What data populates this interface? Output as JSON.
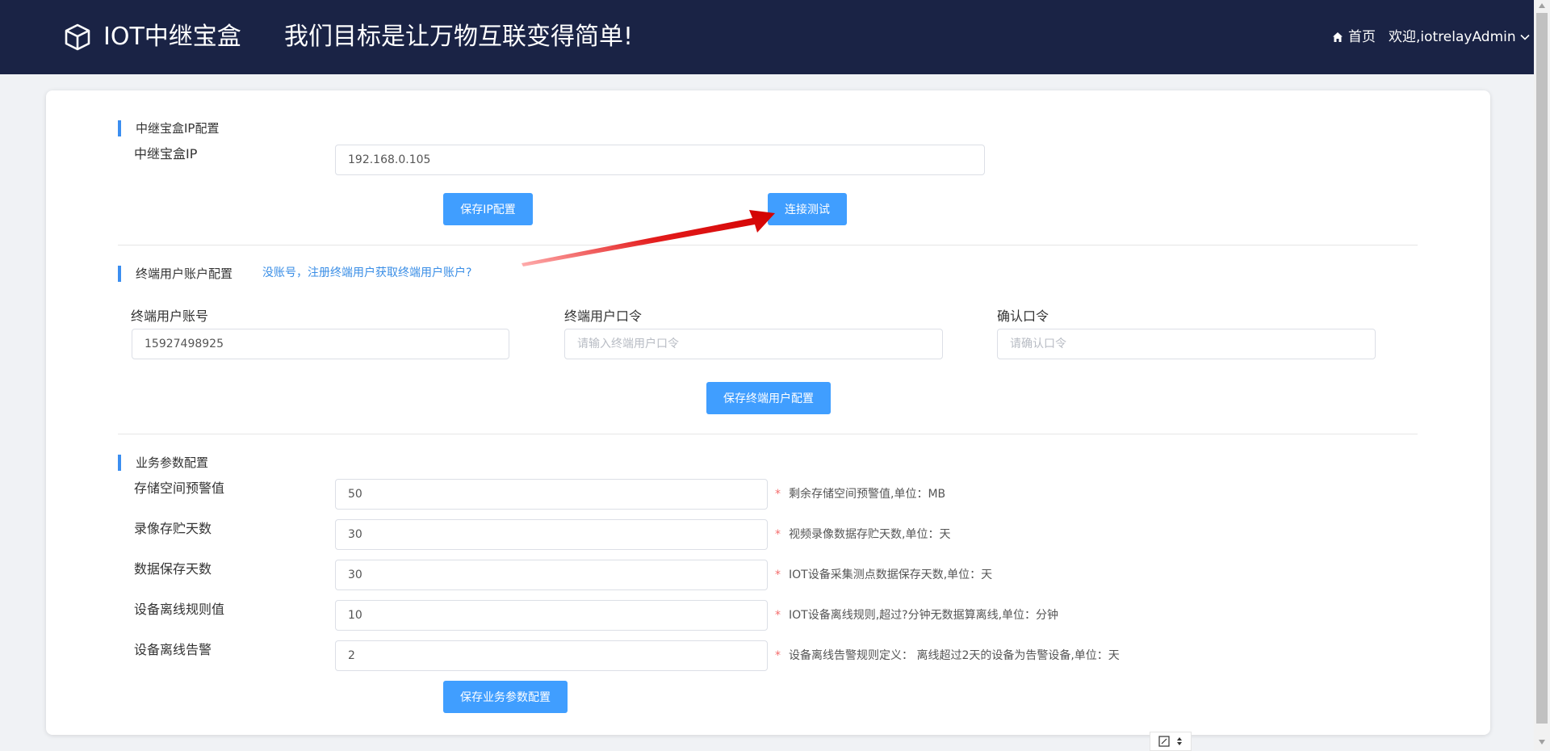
{
  "header": {
    "brand": "IOT中继宝盒",
    "slogan": "我们目标是让万物互联变得简单!",
    "home_label": "首页",
    "user_label": "欢迎,iotrelayAdmin"
  },
  "ip_section": {
    "title": "中继宝盒IP配置",
    "ip_label": "中继宝盒IP",
    "ip_value": "192.168.0.105",
    "save_button": "保存IP配置",
    "test_button": "连接测试"
  },
  "account_section": {
    "title": "终端用户账户配置",
    "register_link": "没账号，注册终端用户获取终端用户账户?",
    "account_label": "终端用户账号",
    "account_value": "15927498925",
    "password_label": "终端用户口令",
    "password_placeholder": "请输入终端用户口令",
    "confirm_label": "确认口令",
    "confirm_placeholder": "请确认口令",
    "save_button": "保存终端用户配置"
  },
  "business_section": {
    "title": "业务参数配置",
    "rows": [
      {
        "label": "存储空间预警值",
        "value": "50",
        "hint": "剩余存储空间预警值,单位：MB"
      },
      {
        "label": "录像存贮天数",
        "value": "30",
        "hint": "视频录像数据存贮天数,单位：天"
      },
      {
        "label": "数据保存天数",
        "value": "30",
        "hint": "IOT设备采集测点数据保存天数,单位：天"
      },
      {
        "label": "设备离线规则值",
        "value": "10",
        "hint": "IOT设备离线规则,超过?分钟无数据算离线,单位：分钟"
      },
      {
        "label": "设备离线告警",
        "value": "2",
        "hint": "设备离线告警规则定义：  离线超过2天的设备为告警设备,单位：天"
      }
    ],
    "required_mark": "*",
    "save_button": "保存业务参数配置"
  },
  "colors": {
    "header_bg": "#1a2345",
    "primary": "#409eff",
    "accent_bar": "#3b8ef0",
    "link": "#3a8ee6",
    "required": "#f56c6c",
    "annotation_arrow": "#e31b1b"
  }
}
